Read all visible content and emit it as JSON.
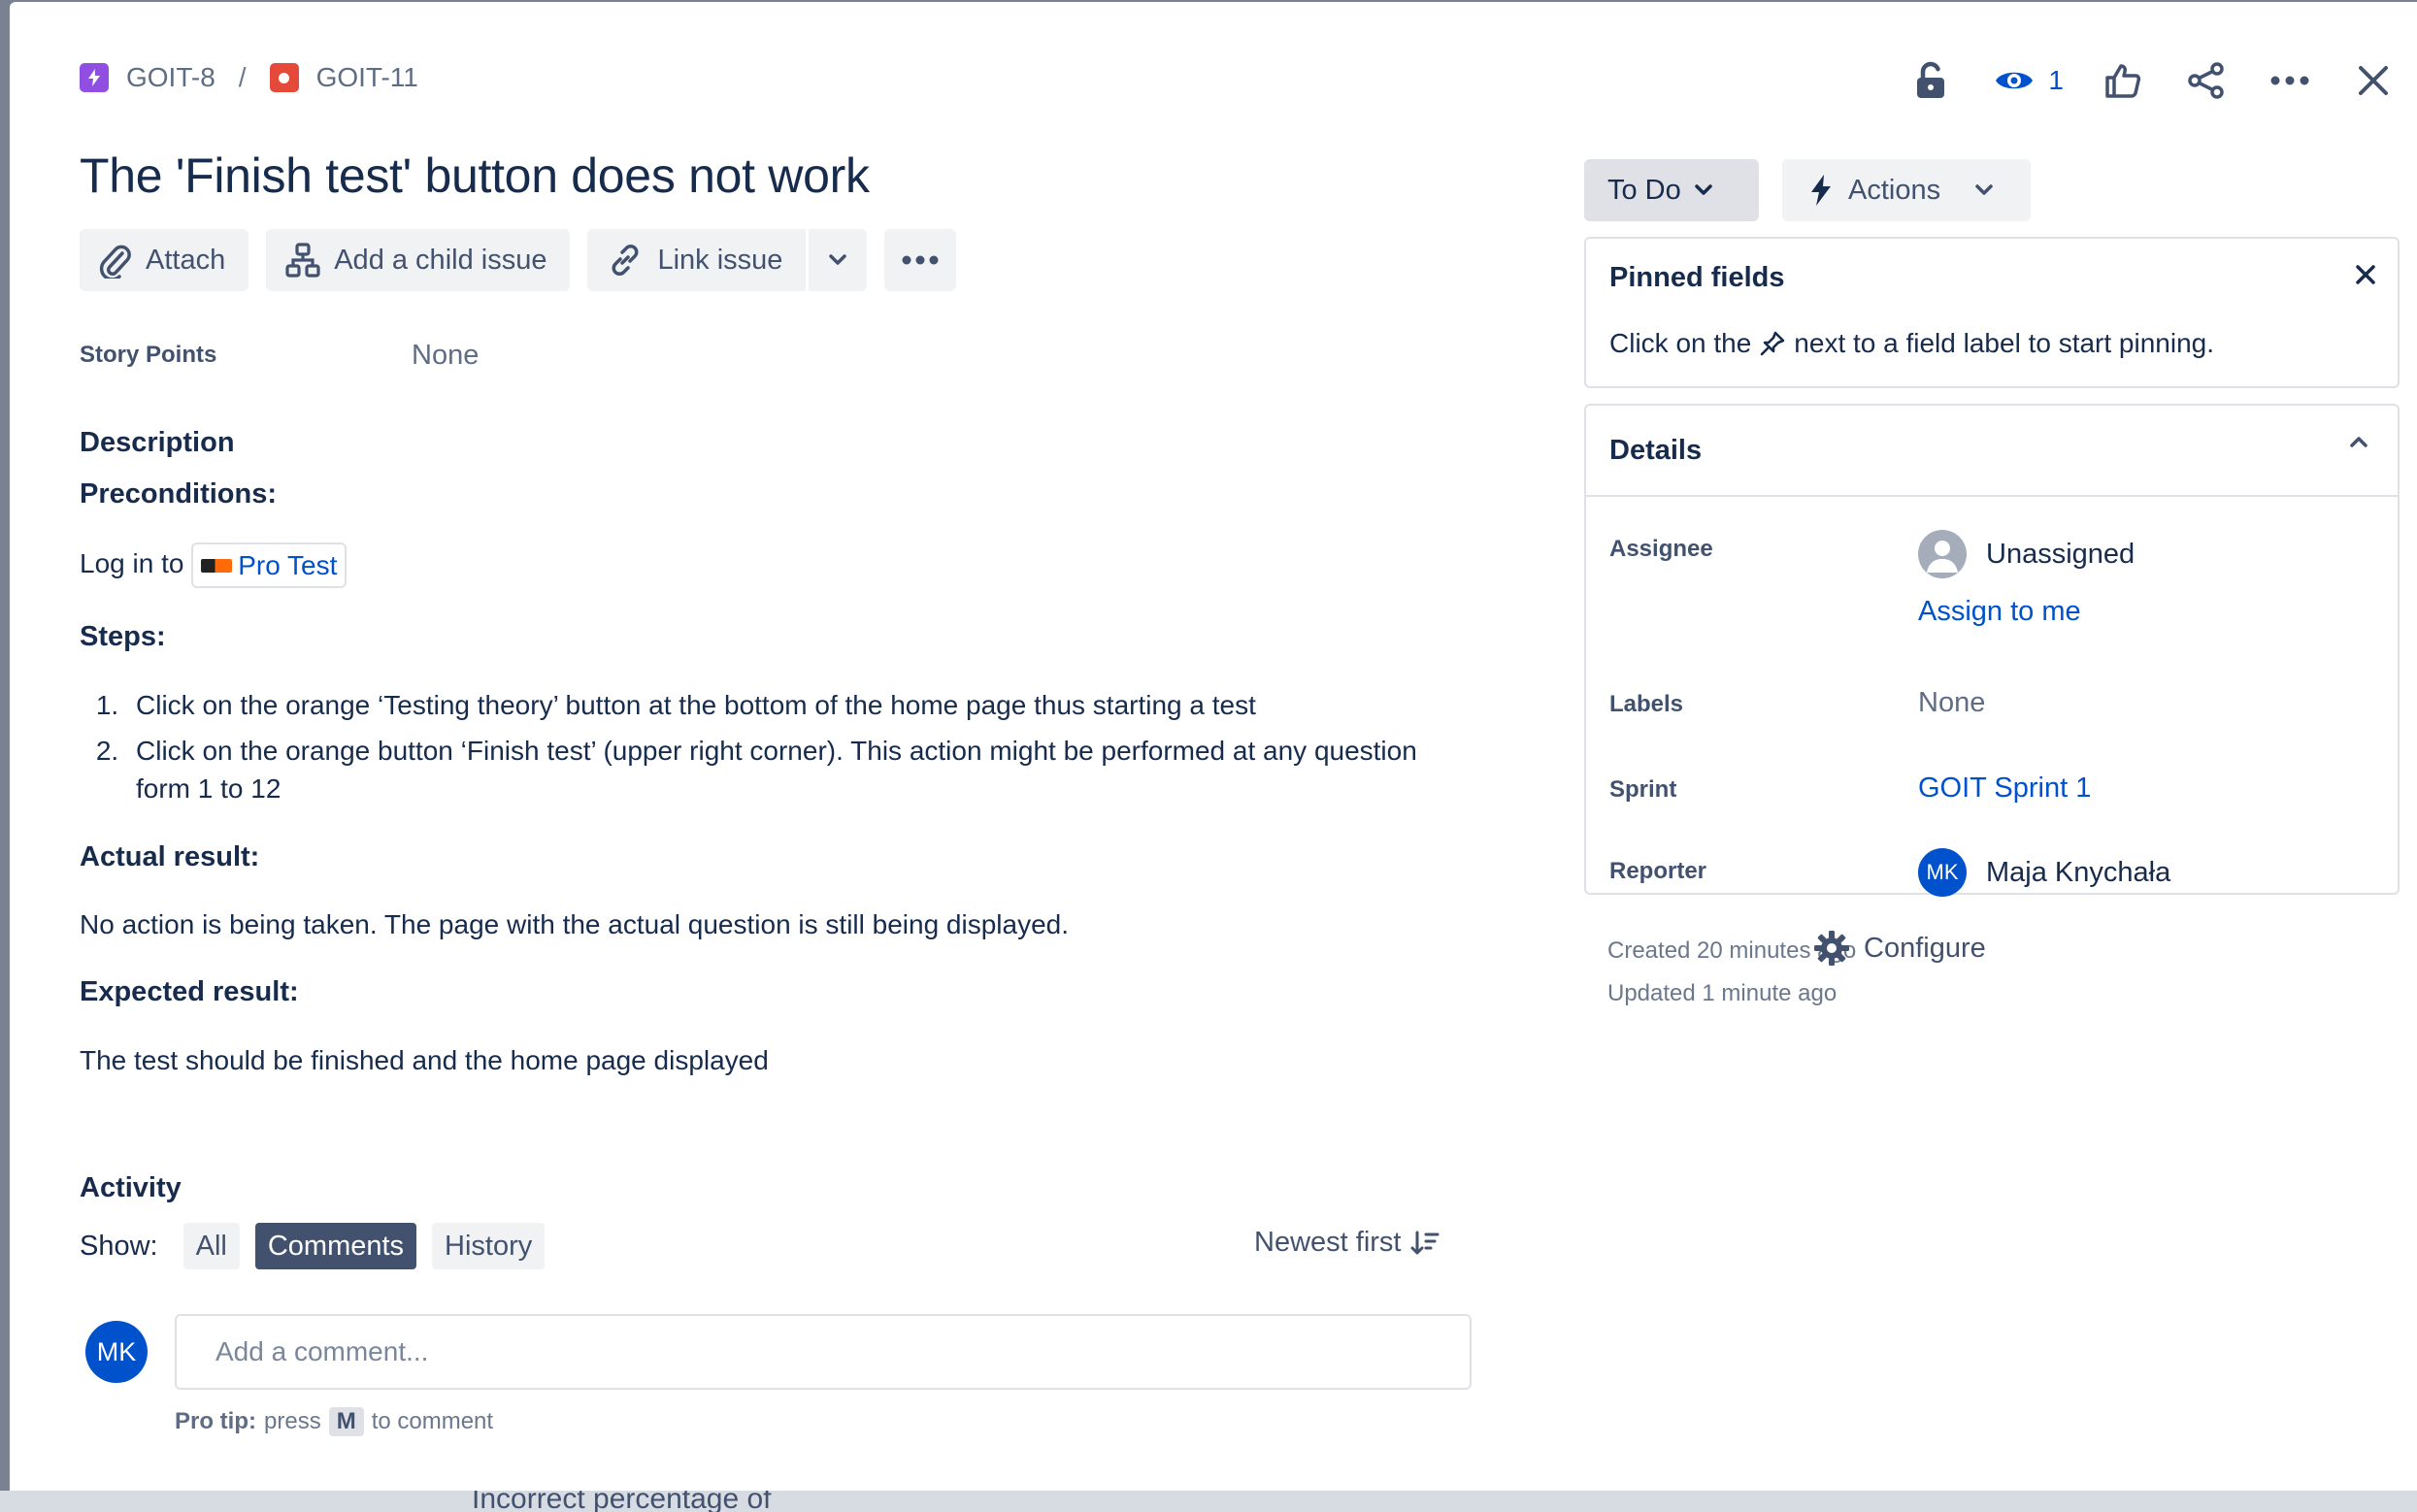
{
  "breadcrumb": {
    "parent_key": "GOIT-8",
    "separator": "/",
    "current_key": "GOIT-11"
  },
  "top_tools": {
    "watch_count": "1"
  },
  "issue": {
    "title": "The 'Finish test' button does not work"
  },
  "action_bar": {
    "attach_label": "Attach",
    "add_child_label": "Add a child issue",
    "link_issue_label": "Link issue"
  },
  "fields": {
    "story_points_label": "Story Points",
    "story_points_value": "None"
  },
  "description": {
    "heading": "Description",
    "preconditions_heading": "Preconditions:",
    "login_prefix": "Log in to",
    "login_link": "Pro Test",
    "steps_heading": "Steps:",
    "steps": [
      "Click on the orange ‘Testing theory’ button at the bottom of the home page thus starting a test",
      "Click on the orange button ‘Finish test’ (upper right corner). This action might be performed at any question form 1 to 12"
    ],
    "actual_heading": "Actual result:",
    "actual_text": "No action is being taken. The page with the actual question is still being displayed.",
    "expected_heading": "Expected result:",
    "expected_text": "The test should be finished and the home page displayed"
  },
  "activity": {
    "title": "Activity",
    "show_label": "Show:",
    "filters": [
      "All",
      "Comments",
      "History"
    ],
    "active_filter": "Comments",
    "sort_label": "Newest first",
    "avatar_initials": "MK",
    "comment_placeholder": "Add a comment...",
    "pro_tip_label": "Pro tip:",
    "pro_tip_press": "press",
    "pro_tip_key": "M",
    "pro_tip_suffix": "to comment"
  },
  "sidebar": {
    "status_label": "To Do",
    "actions_label": "Actions",
    "pinned": {
      "title": "Pinned fields",
      "text_before": "Click on the",
      "text_after": "next to a field label to start pinning."
    },
    "details": {
      "title": "Details",
      "assignee_label": "Assignee",
      "assignee_value": "Unassigned",
      "assign_to_me": "Assign to me",
      "labels_label": "Labels",
      "labels_value": "None",
      "sprint_label": "Sprint",
      "sprint_value": "GOIT Sprint 1",
      "reporter_label": "Reporter",
      "reporter_initials": "MK",
      "reporter_name": "Maja Knychała"
    },
    "created": "Created 20 minutes ago",
    "updated": "Updated 1 minute ago",
    "configure_label": "Configure"
  },
  "backdrop": {
    "text": "Incorrect percentage of"
  },
  "colors": {
    "link": "#0052cc",
    "text": "#172b4d",
    "muted": "#5e6c84",
    "epic_icon": "#904ee2",
    "bug_icon": "#e5493a"
  },
  "icons": [
    "lightning-icon",
    "bug-icon",
    "lock-icon",
    "eye-icon",
    "thumbs-up-icon",
    "share-icon",
    "more-icon",
    "close-icon",
    "paperclip-icon",
    "hierarchy-icon",
    "link-icon",
    "chevron-down-icon",
    "pin-icon",
    "chevron-up-icon",
    "gear-icon",
    "sort-icon"
  ]
}
